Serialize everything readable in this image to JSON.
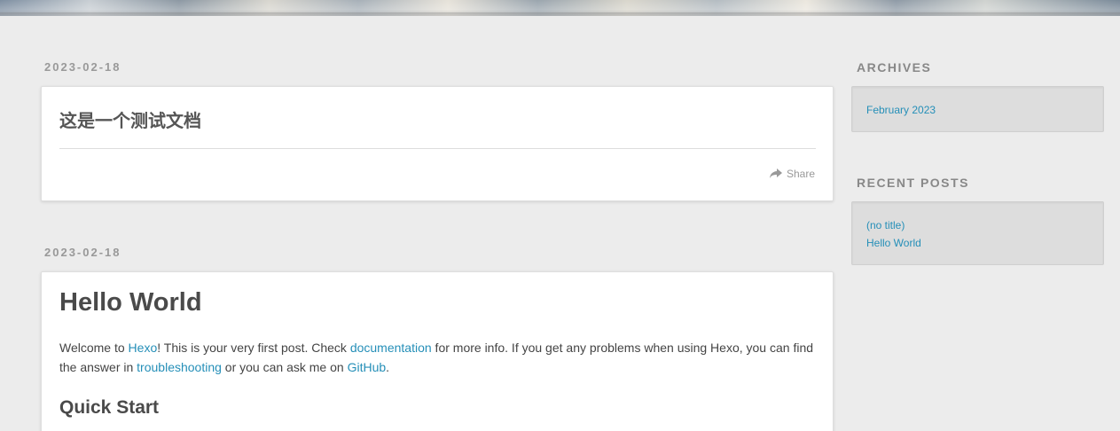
{
  "posts": [
    {
      "date": "2023-02-18",
      "title": "这是一个测试文档",
      "share_label": "Share"
    },
    {
      "date": "2023-02-18",
      "title": "Hello World",
      "body": {
        "t1": "Welcome to ",
        "link_hexo": "Hexo",
        "t2": "! This is your very first post. Check ",
        "link_docs": "documentation",
        "t3": " for more info. If you get any problems when using Hexo, you can find the answer in ",
        "link_troubleshooting": "troubleshooting",
        "t4": " or you can ask me on ",
        "link_github": "GitHub",
        "t5": "."
      },
      "section_heading": "Quick Start"
    }
  ],
  "sidebar": {
    "archives": {
      "title": "ARCHIVES",
      "items": [
        "February 2023"
      ]
    },
    "recent_posts": {
      "title": "RECENT POSTS",
      "items": [
        "(no title)",
        "Hello World"
      ]
    }
  },
  "colors": {
    "link": "#258fb8",
    "background": "#ececec",
    "card": "#ffffff",
    "widget": "#dddddd"
  },
  "icons": {
    "share": "share-arrow-icon"
  }
}
